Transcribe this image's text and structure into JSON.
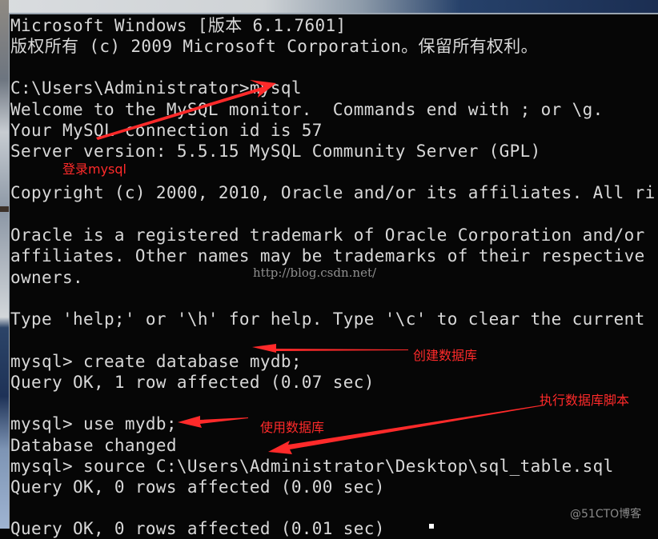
{
  "window": {
    "type": "command-prompt",
    "background_color": "#060606",
    "text_color": "#d8d8d8",
    "annotation_color": "#ff2a2a"
  },
  "console": {
    "lines": [
      "Microsoft Windows [版本 6.1.7601]",
      "版权所有 (c) 2009 Microsoft Corporation。保留所有权利。",
      "",
      "C:\\Users\\Administrator>mysql",
      "Welcome to the MySQL monitor.  Commands end with ; or \\g.",
      "Your MySQL connection id is 57",
      "Server version: 5.5.15 MySQL Community Server (GPL)",
      "",
      "Copyright (c) 2000, 2010, Oracle and/or its affiliates. All ri",
      "",
      "Oracle is a registered trademark of Oracle Corporation and/or",
      "affiliates. Other names may be trademarks of their respective",
      "owners.",
      "",
      "Type 'help;' or '\\h' for help. Type '\\c' to clear the current",
      "",
      "mysql> create database mydb;",
      "Query OK, 1 row affected (0.07 sec)",
      "",
      "mysql> use mydb;",
      "Database changed",
      "mysql> source C:\\Users\\Administrator\\Desktop\\sql_table.sql",
      "Query OK, 0 rows affected (0.00 sec)",
      "",
      "Query OK, 0 rows affected (0.01 sec)"
    ]
  },
  "annotations": {
    "login": "登录mysql",
    "create_db": "创建数据库",
    "use_db": "使用数据库",
    "run_script": "执行数据库脚本"
  },
  "watermarks": {
    "url": "http://blog.csdn.net/",
    "brand": "@51CTO博客"
  }
}
